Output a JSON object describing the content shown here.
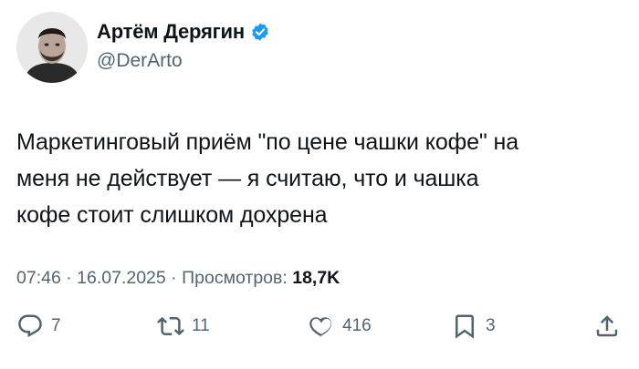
{
  "author": {
    "name": "Артём Дерягин",
    "handle": "@DerArto",
    "verified": true,
    "avatar_icon": "user-photo"
  },
  "tweet": {
    "text_lines": [
      "Маркетинговый приём \"по цене чашки кофе\" на",
      "меня не действует — я считаю, что и чашка",
      "кофе стоит слишком дохрена"
    ]
  },
  "meta": {
    "time": "07:46",
    "separator": " · ",
    "date": "16.07.2025",
    "views_label": "Просмотров:",
    "views_count": "18,7K"
  },
  "actions": {
    "replies": "7",
    "reposts": "11",
    "likes": "416",
    "bookmarks": "3"
  },
  "colors": {
    "text": "#0f1419",
    "secondary": "#536471",
    "verified_badge": "#1d9bf0"
  }
}
